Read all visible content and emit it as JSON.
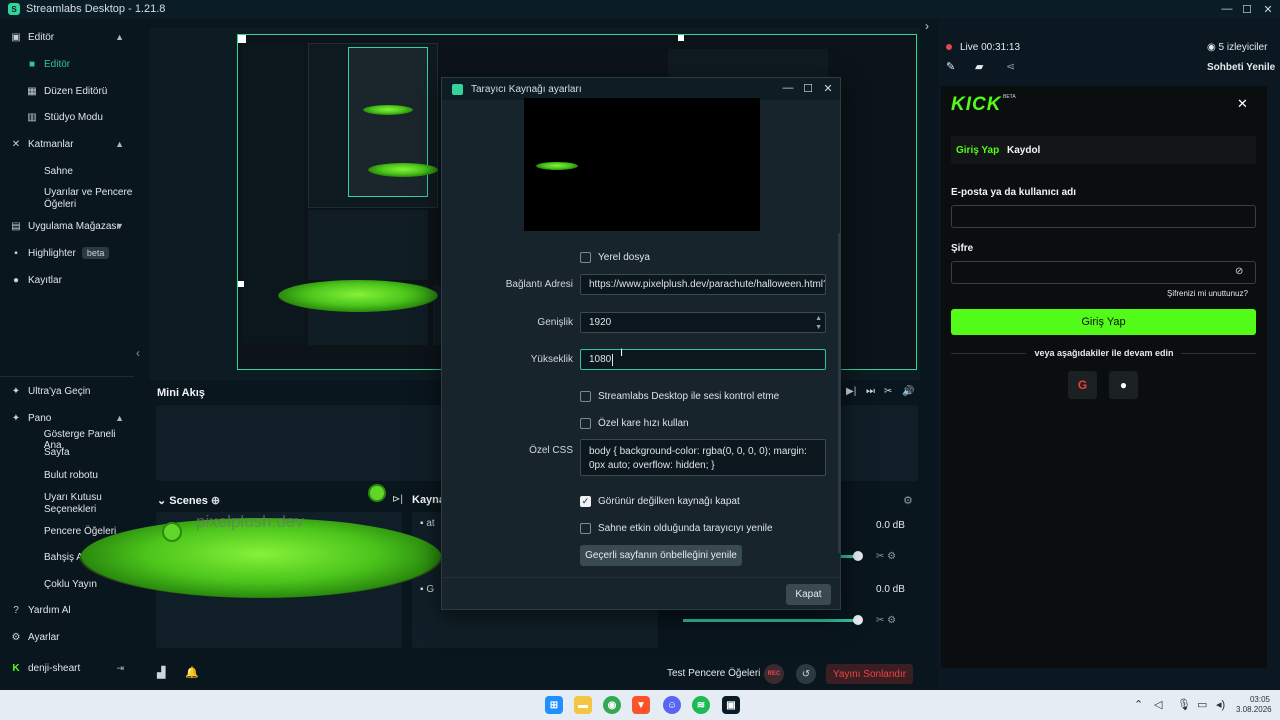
{
  "window": {
    "title": "Streamlabs Desktop - 1.21.8"
  },
  "nav": {
    "editor": "Editör",
    "editor_sub": "Editör",
    "layout_editor": "Düzen Editörü",
    "studio_mode": "Stüdyo Modu",
    "layers": "Katmanlar",
    "scene": "Sahne",
    "alerts_1": "Uyarılar ve Pencere",
    "alerts_2": "Öğeleri",
    "app_store": "Uygulama Mağazası",
    "highlighter": "Highlighter",
    "beta": "beta",
    "recordings": "Kayıtlar",
    "ultra": "Ultra'ya Geçin",
    "dashboard": "Pano",
    "dash_home_1": "Gösterge Paneli Ana",
    "dash_home_2": "Sayfa",
    "cloudbot": "Bulut robotu",
    "alertbox_1": "Uyarı Kutusu",
    "alertbox_2": "Seçenekleri",
    "widgets": "Pencere Öğeleri",
    "donation": "Bahşiş Ayarları",
    "multistream": "Çoklu Yayın",
    "help": "Yardım Al",
    "settings": "Ayarlar",
    "user": "denji-sheart"
  },
  "panels": {
    "mini_feed": "Mini Akış",
    "scenes": "Scenes",
    "sources_partial": "Kayna",
    "source_item_1": "at",
    "source_item_2": "G",
    "db_1": "0.0 dB",
    "db_2": "0.0 dB",
    "watermark": "pixelplush.dev"
  },
  "bottom": {
    "test_widgets": "Test Pencere Öğeleri",
    "rec": "REC",
    "end_stream": "Yayını Sonlandır"
  },
  "dialog": {
    "title": "Tarayıcı Kaynağı ayarları",
    "local_file": "Yerel dosya",
    "url_label": "Bağlantı Adresi",
    "url_value": "https://www.pixelplush.dev/parachute/halloween.html?",
    "width_label": "Genişlik",
    "width_value": "1920",
    "height_label": "Yükseklik",
    "height_value": "1080",
    "control_audio": "Streamlabs Desktop ile sesi kontrol etme",
    "custom_fps": "Özel kare hızı kullan",
    "css_label": "Özel CSS",
    "css_value": "body { background-color: rgba(0, 0, 0, 0); margin: 0px auto; overflow: hidden; }",
    "shutdown_hidden": "Görünür değilken kaynağı kapat",
    "refresh_active": "Sahne etkin olduğunda tarayıcıyı yenile",
    "refresh_cache": "Geçerli sayfanın önbelleğini yenile",
    "close": "Kapat"
  },
  "right": {
    "live": "Live 00:31:13",
    "viewers": "5 izleyiciler",
    "refresh_chat": "Sohbeti Yenile",
    "kick_logo": "KICK",
    "kick_beta": "BETA",
    "tab_login": "Giriş Yap",
    "tab_register": "Kaydol",
    "email_label": "E-posta ya da kullanıcı adı",
    "password_label": "Şifre",
    "forgot": "Şifrenizi mi unuttunuz?",
    "login_button": "Giriş Yap",
    "or_continue": "veya aşağıdakiler ile devam edin"
  },
  "taskbar": {
    "time": "03:05",
    "date": "3.08.2026"
  },
  "colors": {
    "accent": "#34d399",
    "kick_green": "#53fc18",
    "live_red": "#e5484d",
    "end_stream": "#ef4444"
  }
}
